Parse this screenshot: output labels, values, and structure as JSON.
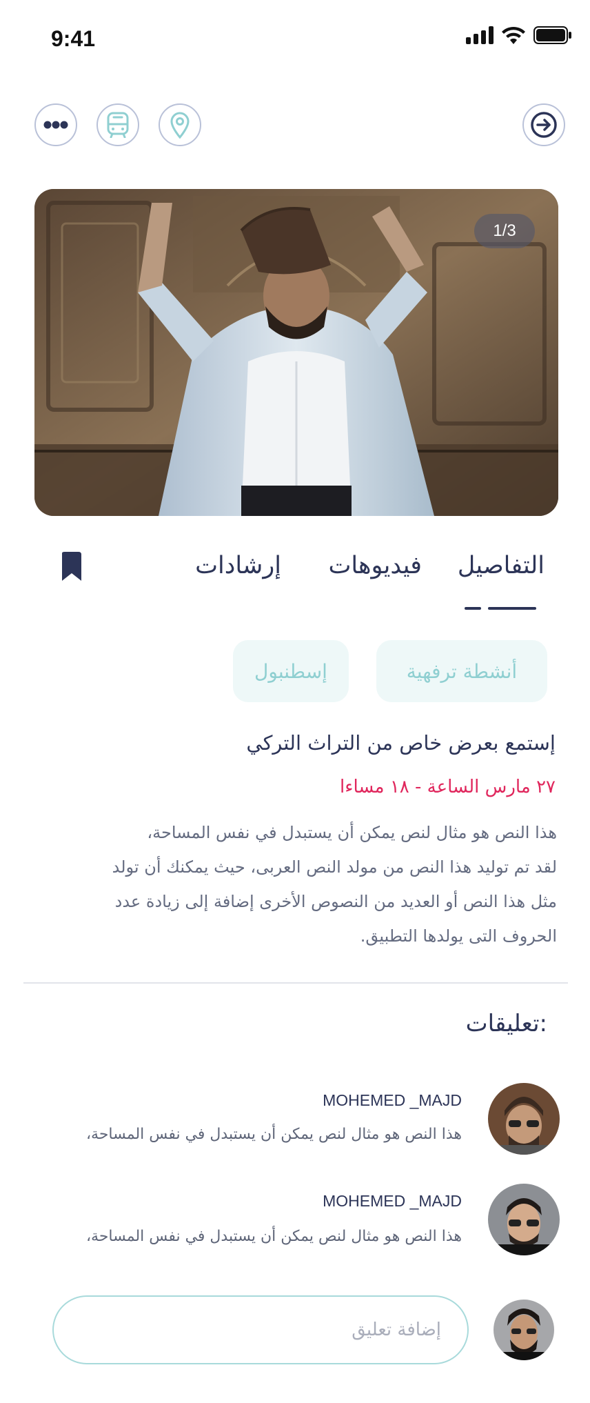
{
  "status_bar": {
    "time": "9:41"
  },
  "hero": {
    "counter": "1/3"
  },
  "tabs": [
    {
      "label": "التفاصيل"
    },
    {
      "label": "فيديوهات"
    },
    {
      "label": "إرشادات"
    }
  ],
  "chips": [
    {
      "label": "أنشطة ترفهية"
    },
    {
      "label": "إسطنبول"
    }
  ],
  "event": {
    "title": "إستمع بعرض خاص من التراث  التركي",
    "date": "٢٧ مارس الساعة - ١٨ مساءا",
    "description_lines": [
      "هذا النص هو مثال لنص يمكن أن يستبدل في نفس المساحة،",
      "لقد تم توليد هذا النص من مولد النص العربى، حيث يمكنك أن تولد",
      "مثل هذا النص أو العديد من النصوص الأخرى إضافة إلى زيادة عدد",
      "الحروف التى يولدها التطبيق."
    ]
  },
  "comments": {
    "title": "تعليقات:",
    "items": [
      {
        "name": "MOHEMED _MAJD",
        "text": "هذا النص هو مثال لنص يمكن أن يستبدل في نفس المساحة،"
      },
      {
        "name": "MOHEMED _MAJD",
        "text": "هذا النص هو مثال لنص يمكن أن يستبدل في نفس المساحة،"
      }
    ],
    "input_placeholder": "إضافة تعليق"
  },
  "colors": {
    "primary": "#2c3457",
    "accent": "#8fcfd1",
    "date": "#e0265c",
    "chip_bg": "#eef8f8"
  },
  "icons": {
    "top_left": [
      "more-icon",
      "bus-icon",
      "location-pin-icon"
    ],
    "top_right": "forward-arrow-icon",
    "tabs_side": "bookmark-icon"
  }
}
